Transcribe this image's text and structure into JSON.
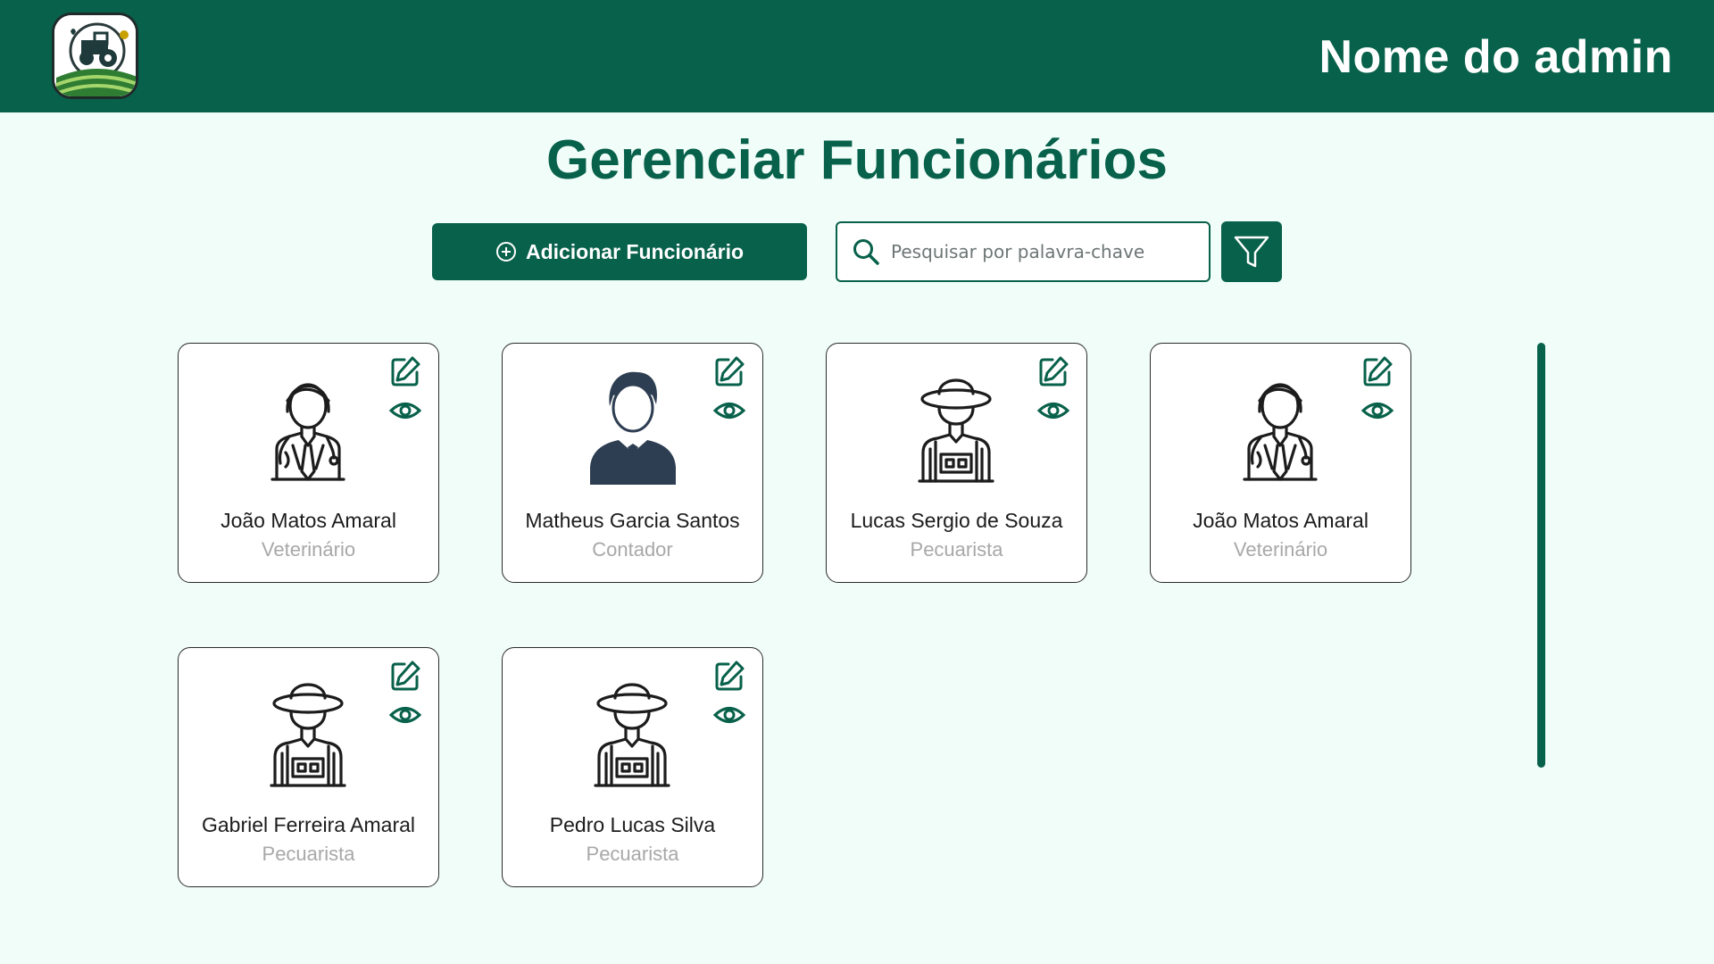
{
  "header": {
    "admin_name": "Nome do admin",
    "logo": "farm-tractor-logo"
  },
  "page": {
    "title": "Gerenciar Funcionários"
  },
  "toolbar": {
    "add_label": "Adicionar Funcionário",
    "search_placeholder": "Pesquisar por palavra-chave",
    "search_value": ""
  },
  "employees": [
    {
      "name": "João Matos Amaral",
      "role": "Veterinário",
      "avatar": "veterinarian"
    },
    {
      "name": "Matheus Garcia Santos",
      "role": "Contador",
      "avatar": "businessman"
    },
    {
      "name": "Lucas Sergio de Souza",
      "role": "Pecuarista",
      "avatar": "farmer"
    },
    {
      "name": "João Matos Amaral",
      "role": "Veterinário",
      "avatar": "veterinarian"
    },
    {
      "name": "Gabriel Ferreira Amaral",
      "role": "Pecuarista",
      "avatar": "farmer"
    },
    {
      "name": "Pedro Lucas Silva",
      "role": "Pecuarista",
      "avatar": "farmer"
    }
  ],
  "colors": {
    "primary": "#08614a",
    "background": "#f0fdf9",
    "role_text": "#a8a8a8"
  }
}
